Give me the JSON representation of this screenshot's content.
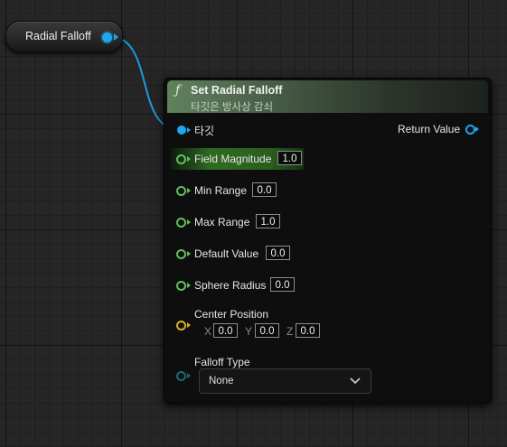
{
  "variable_node": {
    "label": "Radial Falloff",
    "pin_color": "#1ea7f0"
  },
  "function_node": {
    "icon": "ƒ",
    "title": "Set Radial Falloff",
    "subtitle": "타깃은 방사상 감쇠",
    "header_color": "#61825d",
    "target_pin_label": "타깃",
    "return_value_label": "Return Value",
    "inputs": [
      {
        "label": "Field Magnitude",
        "value": "1.0",
        "highlighted": true
      },
      {
        "label": "Min Range",
        "value": "0.0"
      },
      {
        "label": "Max Range",
        "value": "1.0"
      },
      {
        "label": "Default Value",
        "value": "0.0"
      },
      {
        "label": "Sphere Radius",
        "value": "0.0"
      }
    ],
    "center_position": {
      "label": "Center Position",
      "x_label": "X",
      "x_value": "0.0",
      "y_label": "Y",
      "y_value": "0.0",
      "z_label": "Z",
      "z_value": "0.0",
      "pin_color": "#d8b12c"
    },
    "falloff_type": {
      "label": "Falloff Type",
      "selected": "None",
      "pin_color": "#1d6c6c"
    },
    "float_pin_color": "#5fc05f"
  }
}
